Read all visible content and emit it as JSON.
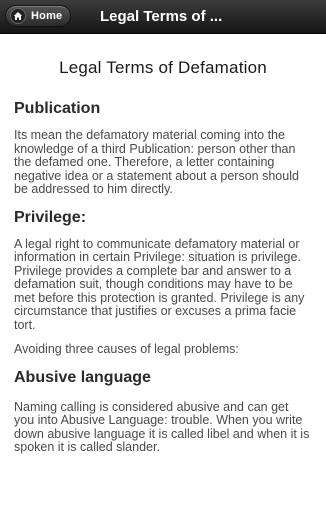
{
  "header": {
    "home_label": "Home",
    "title": "Legal Terms of ..."
  },
  "page": {
    "heading": "Legal Terms of Defamation"
  },
  "sections": [
    {
      "heading": "Publication",
      "text": "Its mean the defamatory material coming into the knowledge of a third Publication: person other than the defamed one. Therefore, a letter containing negative idea or a statement about a person should be addressed to him directly."
    },
    {
      "heading": "Privilege:",
      "text": "A legal right to communicate defamatory material or information in certain Privilege: situation is privilege. Privilege provides a complete bar and answer to a defamation suit, though conditions may have to be met before this protection is granted. Privilege is any circumstance that justifies or excuses a prima facie tort.",
      "note": "Avoiding three causes of legal problems:"
    },
    {
      "heading": "Abusive language",
      "text": "Naming calling is considered abusive and can get you into Abusive Language: trouble. When you write down abusive language it is called libel and when it is spoken it is called slander."
    }
  ]
}
